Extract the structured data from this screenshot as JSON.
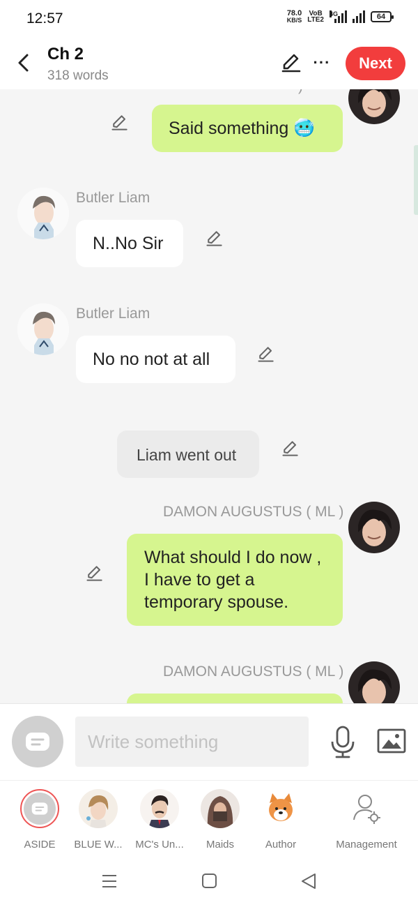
{
  "status_bar": {
    "time": "12:57",
    "speed_value": "78.0",
    "speed_unit": "KB/S",
    "volte_top": "VoB",
    "volte_bottom": "LTE2",
    "network": "4G",
    "battery": "64"
  },
  "header": {
    "title": "Ch 2",
    "subtitle": "318 words",
    "next_label": "Next"
  },
  "messages": [
    {
      "type": "right",
      "text": "Said something 🥶",
      "speaker": "",
      "partial_name": ")"
    },
    {
      "type": "left",
      "speaker": "Butler Liam",
      "text": "N..No Sir"
    },
    {
      "type": "left",
      "speaker": "Butler Liam",
      "text": "No no not at all"
    },
    {
      "type": "aside",
      "text": "Liam went out"
    },
    {
      "type": "right",
      "speaker": "DAMON AUGUSTUS ( ML )",
      "text": "What should I do now , I have to get a temporary spouse."
    },
    {
      "type": "right",
      "speaker": "DAMON AUGUSTUS ( ML )",
      "text": ""
    }
  ],
  "input": {
    "placeholder": "Write something"
  },
  "characters": [
    {
      "label": "ASIDE",
      "icon": "aside-chat-icon"
    },
    {
      "label": "BLUE W...",
      "icon": "blue-w-avatar"
    },
    {
      "label": "MC's Un...",
      "icon": "mc-uncle-avatar"
    },
    {
      "label": "Maids",
      "icon": "maids-avatar"
    },
    {
      "label": "Author",
      "icon": "shiba-dog-avatar"
    },
    {
      "label": "Management",
      "icon": "user-gear-icon"
    }
  ],
  "colors": {
    "accent_red": "#f23d3d",
    "bubble_green": "#d6f58f",
    "background": "#f5f5f5"
  }
}
